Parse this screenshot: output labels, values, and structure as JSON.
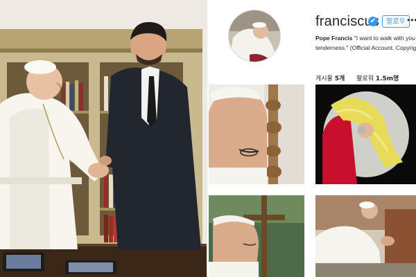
{
  "profile": {
    "username": "franciscus",
    "verified_mark": "✔",
    "follow_label": "팔로우",
    "more_label": "•••",
    "bio_name": "Pope Francis",
    "bio_line1_rest": " \"I want to walk with you al",
    "bio_line2": "tenderness.\" (Official Account. Copyrigh",
    "stats": {
      "posts_label": "게시물",
      "posts_value": "5개",
      "followers_label": "팔로워",
      "followers_value": "1.5m명"
    }
  },
  "icons": {
    "verified": "verified-badge-icon",
    "more": "more-options-icon"
  },
  "colors": {
    "accent": "#3897f0",
    "text": "#262626",
    "divider": "#dbdbdb"
  }
}
